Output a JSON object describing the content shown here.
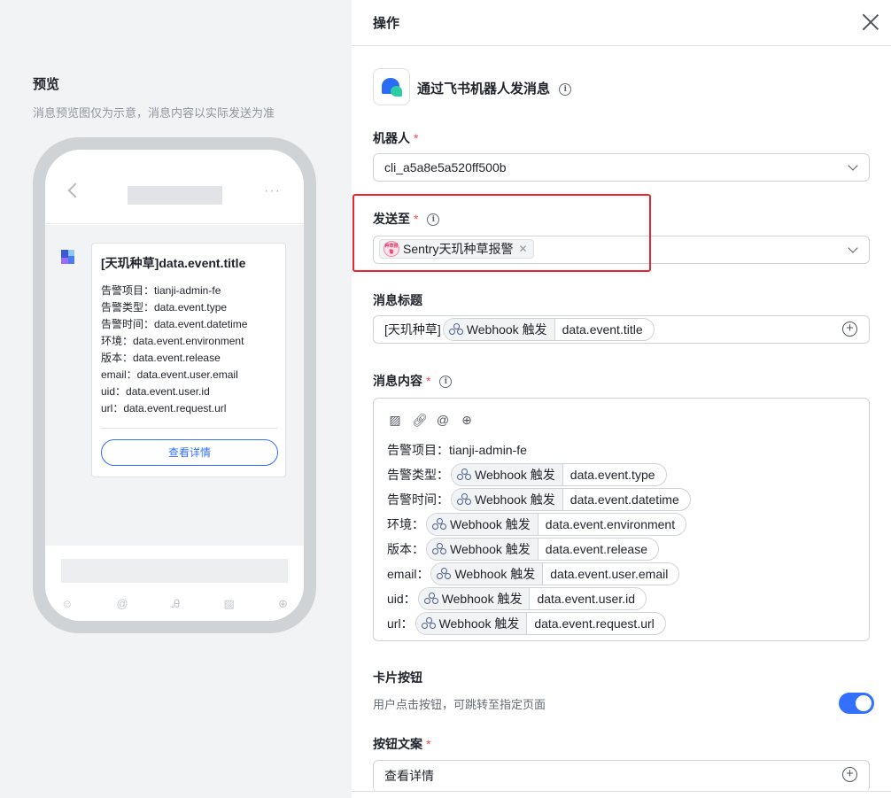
{
  "preview": {
    "title": "预览",
    "subtitle": "消息预览图仅为示意，消息内容以实际发送为准",
    "more_label": "···",
    "card": {
      "title": "[天玑种草]data.event.title",
      "lines": [
        "告警项目：tianji-admin-fe",
        "告警类型：data.event.type",
        "告警时间：data.event.datetime",
        "环境：data.event.environment",
        "版本：data.event.release",
        "email：data.event.user.email",
        "uid：data.event.user.id",
        "url：data.event.request.url"
      ],
      "button": "查看详情"
    },
    "toolbar_icons": [
      "emoji-icon",
      "at-icon",
      "font-icon",
      "image-icon",
      "plus-icon"
    ]
  },
  "drawer": {
    "title": "操作",
    "action_name": "通过飞书机器人发消息",
    "robot": {
      "label": "机器人",
      "value": "cli_a5a8e5a520ff500b"
    },
    "send_to": {
      "label": "发送至",
      "tag": "Sentry天玑种草报警",
      "tag_avatar": "种草报警"
    },
    "msg_title": {
      "label": "消息标题",
      "prefix": "[天玑种草]",
      "var": {
        "source": "Webhook 触发",
        "path": "data.event.title"
      }
    },
    "msg_content": {
      "label": "消息内容",
      "lines": [
        {
          "text": "告警项目：tianji-admin-fe"
        },
        {
          "text": "告警类型：",
          "source": "Webhook 触发",
          "path": "data.event.type"
        },
        {
          "text": "告警时间：",
          "source": "Webhook 触发",
          "path": "data.event.datetime"
        },
        {
          "text": "环境：",
          "source": "Webhook 触发",
          "path": "data.event.environment"
        },
        {
          "text": "版本：",
          "source": "Webhook 触发",
          "path": "data.event.release"
        },
        {
          "text": "email：",
          "source": "Webhook 触发",
          "path": "data.event.user.email"
        },
        {
          "text": "uid：",
          "source": "Webhook 触发",
          "path": "data.event.user.id"
        },
        {
          "text": "url：",
          "source": "Webhook 触发",
          "path": "data.event.request.url"
        }
      ]
    },
    "card_button": {
      "label": "卡片按钮",
      "hint": "用户点击按钮，可跳转至指定页面",
      "enabled": true
    },
    "button_text": {
      "label": "按钮文案",
      "value": "查看详情"
    }
  },
  "colors": {
    "accent": "#3370ff",
    "required": "#f54a45",
    "highlight": "#e8262b"
  }
}
